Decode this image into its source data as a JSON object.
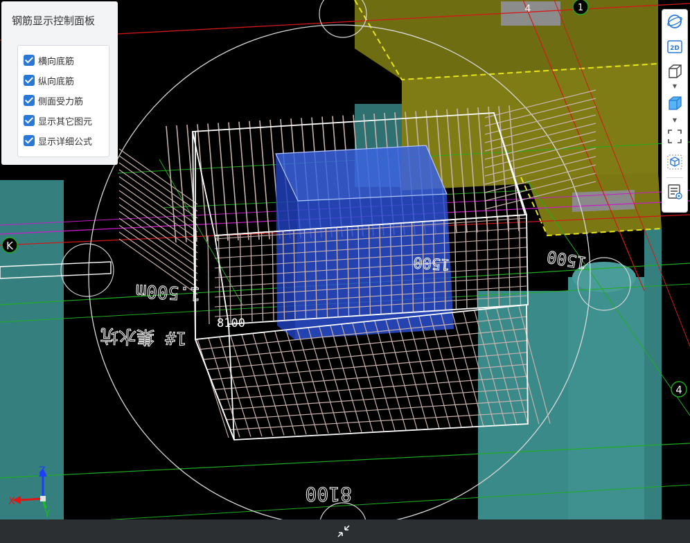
{
  "control_panel": {
    "title": "钢筋显示控制面板",
    "options": [
      {
        "label": "横向底筋",
        "checked": true
      },
      {
        "label": "纵向底筋",
        "checked": true
      },
      {
        "label": "侧面受力筋",
        "checked": true
      },
      {
        "label": "显示其它图元",
        "checked": true
      },
      {
        "label": "显示详细公式",
        "checked": true
      }
    ]
  },
  "toolbar": {
    "buttons": [
      "orbit-icon",
      "2d-view-icon",
      "wireframe-cube-icon",
      "solid-cube-icon",
      "fit-view-icon",
      "isometric-view-icon",
      "layer-list-icon"
    ],
    "view_2d_label": "2D"
  },
  "scene_labels": {
    "grid_k": "K",
    "grid_4_right": "4",
    "grid_4_top": "4",
    "grid_1_top": "1",
    "dim_8100_upper": "8100",
    "dim_8100_lower": "8100",
    "dim_1500_left": "1.500m",
    "dim_1500_center": "1500",
    "dim_1500_right": "1500",
    "pit_label": "1# 集水坑"
  },
  "axis": {
    "x": "X",
    "y": "Y",
    "z": "Z"
  },
  "colors": {
    "background": "#000000",
    "column": "#3a8a89",
    "slab": "#7d7a14",
    "pit_block": "#2c55d6",
    "rebar": "#c9b2ac",
    "frame": "#ffffff",
    "grid_green": "#1fae1f",
    "grid_red": "#d41818",
    "magenta": "#c81cc8",
    "panel_check": "#2a78d6"
  }
}
